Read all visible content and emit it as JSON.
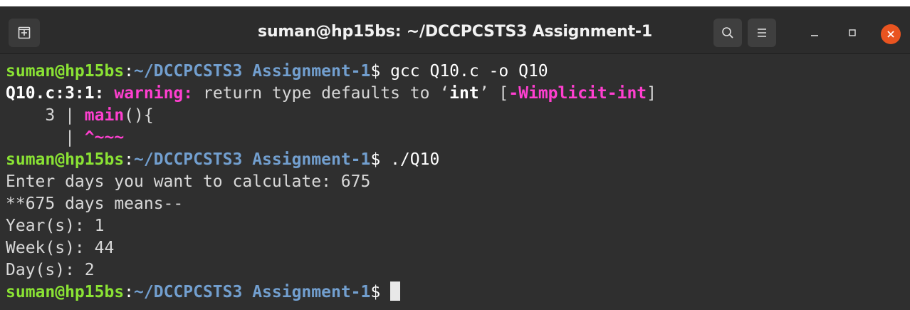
{
  "window": {
    "title": "suman@hp15bs: ~/DCCPCSTS3 Assignment-1",
    "icons": {
      "new_tab": "new-tab-icon",
      "search": "search-icon",
      "menu": "hamburger-menu-icon",
      "minimize": "minimize-icon",
      "maximize": "maximize-icon",
      "close": "close-icon"
    },
    "colors": {
      "titlebar": "#2c2c2c",
      "terminal_bg": "#2f2f2f",
      "close_button": "#e95420"
    }
  },
  "terminal": {
    "colors": {
      "prompt_user": "#8ae234",
      "prompt_path": "#729fcf",
      "warning": "#ff3fd0",
      "text": "#d8d8d8"
    },
    "prompt": {
      "user_host": "suman@hp15bs",
      "colon": ":",
      "path": "~/DCCPCSTS3 Assignment-1",
      "symbol": "$"
    },
    "lines": {
      "l1_command": " gcc Q10.c -o Q10",
      "l2_location": "Q10.c:3:1:",
      "l2_warning_label": "warning:",
      "l2_msg_a": " return type defaults to ",
      "l2_quote_open": "‘",
      "l2_type": "int",
      "l2_quote_close": "’",
      "l2_bracket_open": " [",
      "l2_flag": "-Wimplicit-int",
      "l2_bracket_close": "]",
      "l3_gutter": "    3 | ",
      "l3_code_fn": "main",
      "l3_code_rest": "(){",
      "l4_gutter": "      | ",
      "l4_marker": "^~~~",
      "l5_command": " ./Q10",
      "l6": "Enter days you want to calculate: 675",
      "l7": "**675 days means--",
      "l8": "Year(s): 1",
      "l9": "Week(s): 44",
      "l10": "Day(s): 2",
      "l11_command": " "
    }
  }
}
